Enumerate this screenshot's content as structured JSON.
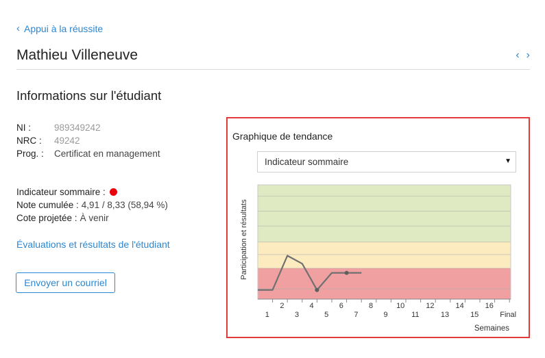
{
  "header": {
    "back_label": "Appui à la réussite",
    "student_name": "Mathieu Villeneuve"
  },
  "section": {
    "title": "Informations sur l'étudiant"
  },
  "info": {
    "ni_label": "NI :",
    "ni_value": "989349242",
    "nrc_label": "NRC :",
    "nrc_value": "49242",
    "prog_label": "Prog. :",
    "prog_value": "Certificat en management"
  },
  "summary": {
    "indicator_label": "Indicateur sommaire :",
    "indicator_color": "#e8000b",
    "grade_label": "Note cumulée :",
    "grade_value": "4,91 / 8,33 (58,94 %)",
    "projected_label": "Cote projetée :",
    "projected_value": "À venir"
  },
  "links": {
    "evaluations": "Évaluations et résultats de l'étudiant"
  },
  "buttons": {
    "email": "Envoyer un courriel"
  },
  "trend": {
    "title": "Graphique de tendance",
    "select_value": "Indicateur sommaire"
  },
  "chart_data": {
    "type": "line",
    "ylabel": "Participation et résultats",
    "xlabel": "Semaines",
    "x_ticks": [
      "1",
      "2",
      "3",
      "4",
      "5",
      "6",
      "7",
      "8",
      "9",
      "10",
      "11",
      "12",
      "13",
      "14",
      "15",
      "16",
      "Final"
    ],
    "bands": [
      {
        "color": "#f0a0a0",
        "from": 0,
        "to": 0.27
      },
      {
        "color": "#fdebc0",
        "from": 0.27,
        "to": 0.5
      },
      {
        "color": "#dfe9c2",
        "from": 0.5,
        "to": 1.0
      }
    ],
    "series": [
      {
        "color": "#707070",
        "points": [
          [
            0,
            0.08
          ],
          [
            1,
            0.08
          ],
          [
            2,
            0.38
          ],
          [
            3,
            0.31
          ],
          [
            4,
            0.08
          ],
          [
            5,
            0.23
          ],
          [
            6,
            0.23
          ],
          [
            7,
            0.23
          ]
        ],
        "markers": [
          4,
          6
        ]
      }
    ]
  }
}
